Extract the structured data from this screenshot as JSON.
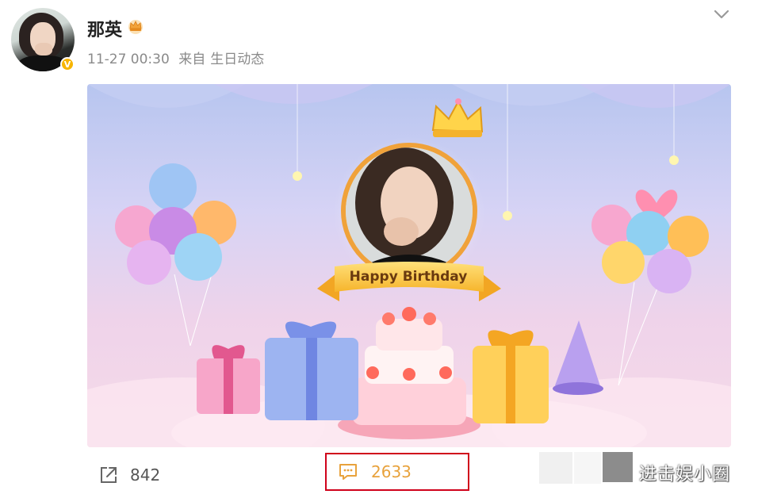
{
  "post": {
    "username": "那英",
    "time": "11-27 00:30",
    "source_prefix": "来自",
    "source": "生日动态",
    "verified_mark": "V"
  },
  "card": {
    "banner_text": "Happy Birthday"
  },
  "actions": {
    "repost_count": "842",
    "comment_count": "2633"
  },
  "watermark": {
    "text": "进击娱小圈"
  },
  "colors": {
    "comment_highlight": "#d0021b",
    "comment_text": "#e8a23c",
    "verified": "#f7b500"
  },
  "icons": [
    "crown-badge-icon",
    "chevron-down-icon",
    "repost-icon",
    "comment-icon",
    "verified-icon"
  ]
}
